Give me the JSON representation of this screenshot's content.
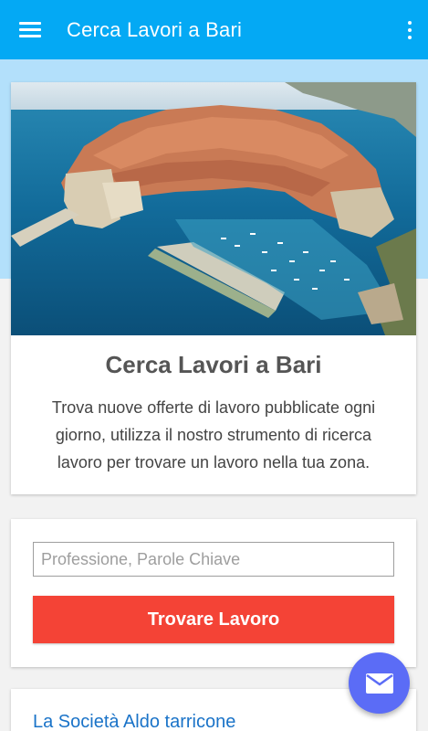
{
  "appbar": {
    "title": "Cerca Lavori a Bari",
    "menu_icon": "hamburger-menu-icon",
    "more_icon": "more-vert-icon",
    "color": "#04a9f4"
  },
  "hero": {
    "image": "aerial-coastal-old-town-photo",
    "title": "Cerca Lavori a Bari",
    "description": "Trova nuove offerte di lavoro pubblicate ogni giorno, utilizza il nostro strumento di ricerca lavoro per trovare un lavoro nella tua zona."
  },
  "search": {
    "placeholder": "Professione, Parole Chiave",
    "value": "",
    "button_label": "Trovare Lavoro",
    "button_color": "#f44336"
  },
  "list": {
    "first_item": "La Società Aldo tarricone"
  },
  "fab": {
    "icon": "mail-icon",
    "color": "#5b6cf6"
  }
}
